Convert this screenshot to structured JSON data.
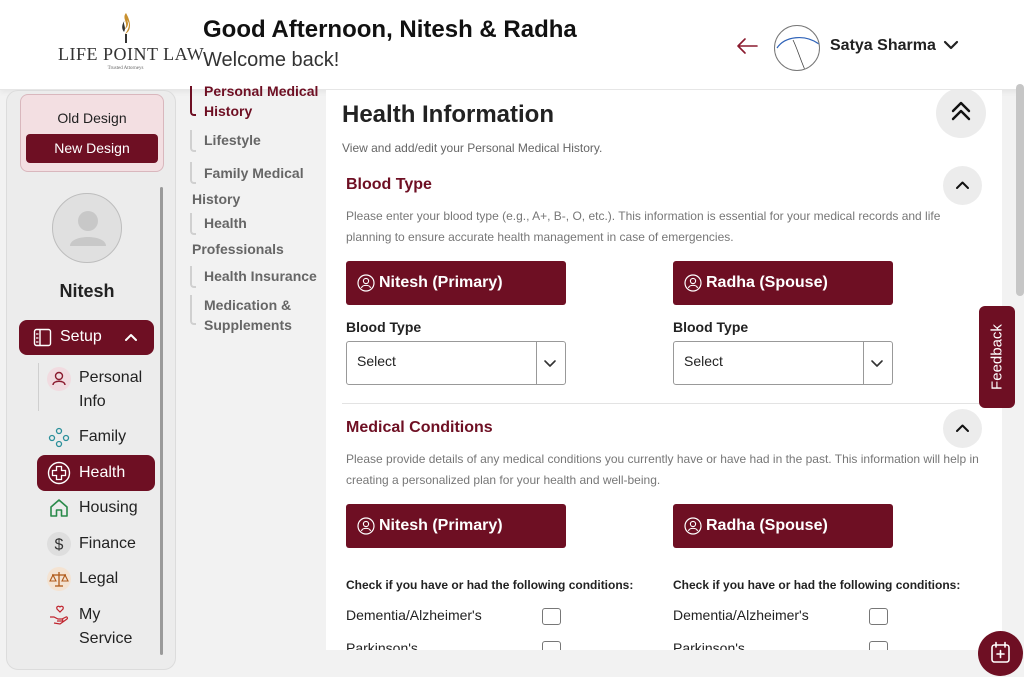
{
  "header": {
    "logo_text": "LIFE POINT LAW",
    "logo_tagline": "Trusted Attorneys",
    "greeting": "Good Afternoon, Nitesh & Radha",
    "welcome": "Welcome back!",
    "user_name": "Satya Sharma"
  },
  "sidebar": {
    "old_design": "Old Design",
    "new_design": "New Design",
    "profile_name": "Nitesh",
    "setup_label": "Setup",
    "items": [
      {
        "label": "Personal Info",
        "icon": "person-icon"
      },
      {
        "label": "Family",
        "icon": "family-icon"
      },
      {
        "label": "Health",
        "icon": "health-plus-icon",
        "active": true
      },
      {
        "label": "Housing",
        "icon": "home-icon"
      },
      {
        "label": "Finance",
        "icon": "dollar-icon"
      },
      {
        "label": "Legal",
        "icon": "scales-icon"
      },
      {
        "label": "My Service",
        "icon": "service-hand-icon"
      }
    ]
  },
  "subnav": {
    "items": [
      {
        "label": "Personal Medical History",
        "active": true
      },
      {
        "label": "Lifestyle"
      },
      {
        "label": "Family Medical History"
      },
      {
        "label": "Health Professionals"
      },
      {
        "label": "Health Insurance"
      },
      {
        "label": "Medication & Supplements"
      }
    ]
  },
  "main": {
    "title": "Health Information",
    "subtitle": "View and add/edit your Personal Medical History.",
    "blood_type": {
      "title": "Blood Type",
      "description": "Please enter your blood type (e.g., A+, B-, O, etc.). This information is essential for your medical records and life planning to ensure accurate health management in case of emergencies.",
      "primary": "Nitesh (Primary)",
      "spouse": "Radha (Spouse)",
      "field_label": "Blood Type",
      "primary_value": "Select",
      "spouse_value": "Select"
    },
    "medical_conditions": {
      "title": "Medical Conditions",
      "description": "Please provide details of any medical conditions you currently have or have had in the past. This information will help in creating a personalized plan for your health and well-being.",
      "primary": "Nitesh (Primary)",
      "spouse": "Radha (Spouse)",
      "check_heading": "Check if you have or had the following conditions:",
      "conditions": [
        "Dementia/Alzheimer's",
        "Parkinson's"
      ]
    }
  },
  "feedback_label": "Feedback",
  "colors": {
    "brand": "#6e0f23",
    "brand_light": "#f3dfe2"
  }
}
